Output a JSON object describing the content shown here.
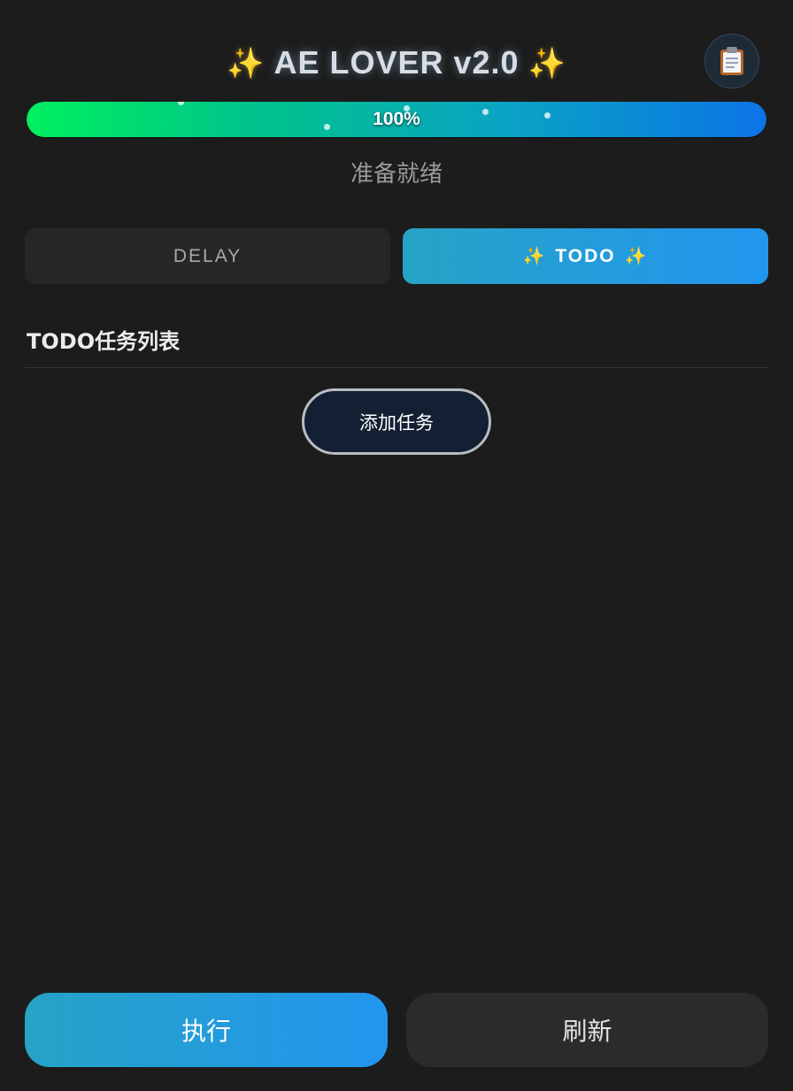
{
  "header": {
    "title": "AE LOVER v2.0",
    "sparkle_left": "✨",
    "sparkle_right": "✨",
    "clipboard_icon": "clipboard-icon"
  },
  "progress": {
    "value": 1.0,
    "label": "100%",
    "colors": [
      "#00f060",
      "#0b74e6"
    ]
  },
  "status": {
    "text": "准备就绪"
  },
  "tabs": [
    {
      "label": "DELAY",
      "active": false
    },
    {
      "label": "TODO",
      "active": true,
      "sparkle": "✨"
    }
  ],
  "todo": {
    "section_title": "TODO任务列表",
    "add_button_label": "添加任务"
  },
  "footer": {
    "run_label": "执行",
    "refresh_label": "刷新"
  },
  "colors": {
    "background": "#1c1c1c",
    "accent_gradient_start": "#27a3c6",
    "accent_gradient_end": "#2196ee"
  }
}
